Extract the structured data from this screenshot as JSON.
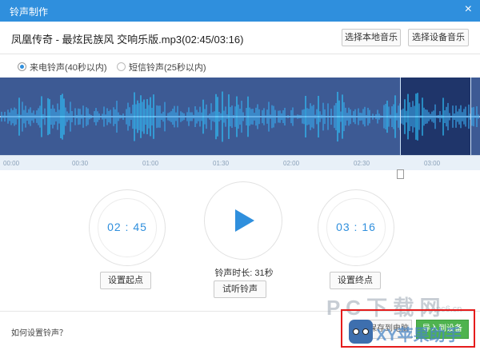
{
  "window": {
    "title": "铃声制作",
    "close_label": "×"
  },
  "song": {
    "name": "凤凰传奇 - 最炫民族风 交响乐版.mp3(02:45/03:16)",
    "btn_local": "选择本地音乐",
    "btn_device": "选择设备音乐"
  },
  "ringtone_type": {
    "call": "来电铃声(40秒以内)",
    "sms": "短信铃声(25秒以内)",
    "selected": "call"
  },
  "timeline": {
    "ticks": [
      "00:00",
      "00:30",
      "01:00",
      "01:30",
      "02:00",
      "02:30",
      "03:00"
    ]
  },
  "editor": {
    "start_time": "02 : 45",
    "end_time": "03 : 16",
    "duration_label": "铃声时长: 31秒",
    "btn_set_start": "设置起点",
    "btn_set_end": "设置终点",
    "btn_preview": "试听铃声"
  },
  "footer": {
    "help": "如何设置铃声？",
    "btn_save": "保存到电脑",
    "btn_add": "导入到设备"
  },
  "watermark": {
    "pc": "P C 下 载 网",
    "site": "pc6.cn",
    "brand": "XY苹果助手"
  }
}
